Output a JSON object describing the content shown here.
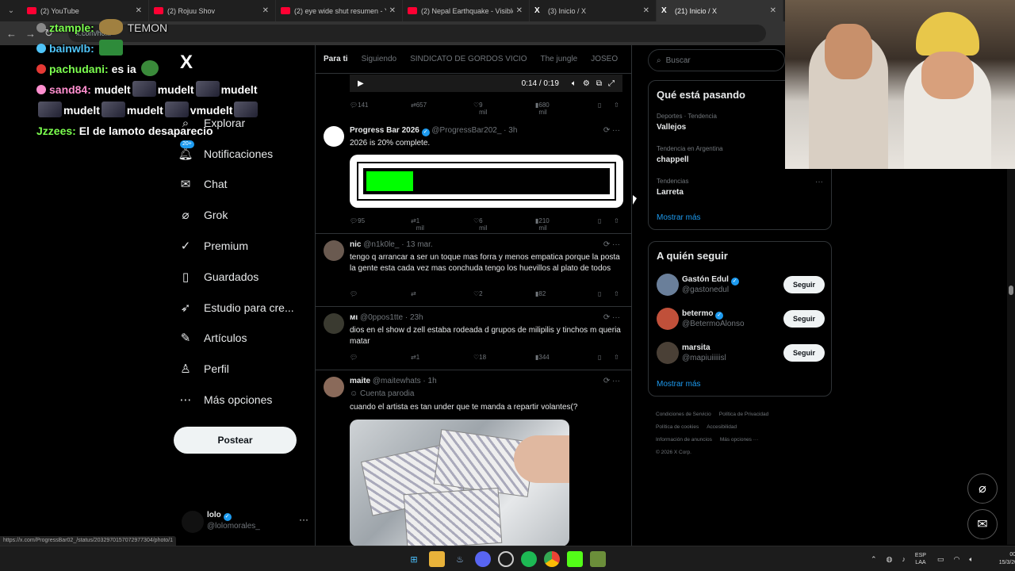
{
  "browser": {
    "tabs": [
      {
        "title": "(2) YouTube",
        "icon": "youtube-icon"
      },
      {
        "title": "(2) Rojuu Shov",
        "icon": "youtube-icon"
      },
      {
        "title": "(2) eye wide shut resumen - Yo",
        "icon": "youtube-icon"
      },
      {
        "title": "(2) Nepal Earthquake - Visible",
        "icon": "youtube-icon"
      },
      {
        "title": "(3) Inicio / X",
        "icon": "x-icon"
      },
      {
        "title": "(21) Inicio / X",
        "icon": "x-icon"
      }
    ],
    "url": "x.com/ho...",
    "status_url": "https://x.com/ProgressBar02_/status/2032970157072977304/photo/1"
  },
  "chat": {
    "lines": [
      {
        "user": "ztample:",
        "msg": "",
        "extra": "TEMON"
      },
      {
        "user": "bainwlb:",
        "msg": ""
      },
      {
        "user": "pachudani:",
        "msg": "es ia"
      },
      {
        "user": "sand84:",
        "msg": "mudelt",
        "msg2": "mudelt",
        "msg3": "mudelt"
      },
      {
        "user": "",
        "msg": "mudelt",
        "msg2": "mudelt",
        "msg3": "vmudelt"
      },
      {
        "user": "Jzzees:",
        "msg": "El de lamoto desaparecio"
      }
    ]
  },
  "sidebar": {
    "logo": "X",
    "items": [
      {
        "label": "Explorar",
        "icon": "search-icon"
      },
      {
        "label": "Notificaciones",
        "icon": "bell-icon",
        "badge": "20+"
      },
      {
        "label": "Chat",
        "icon": "mail-icon"
      },
      {
        "label": "Grok",
        "icon": "grok-icon"
      },
      {
        "label": "Premium",
        "icon": "verified-icon"
      },
      {
        "label": "Guardados",
        "icon": "bookmark-icon"
      },
      {
        "label": "Estudio para cre...",
        "icon": "rocket-icon"
      },
      {
        "label": "Artículos",
        "icon": "article-icon"
      },
      {
        "label": "Perfil",
        "icon": "person-icon"
      },
      {
        "label": "Más opciones",
        "icon": "more-icon"
      }
    ],
    "post_button": "Postear",
    "account": {
      "name": "lolo",
      "handle": "@lolomorales_"
    }
  },
  "feed": {
    "tabs": [
      "Para ti",
      "Siguiendo",
      "SINDICATO DE GORDOS VICIO",
      "The jungle",
      "JOSEO"
    ],
    "video": {
      "time": "0:14 / 0:19"
    },
    "video_actions": {
      "replies": "141",
      "reposts": "657",
      "likes": "9 mil",
      "views": "680 mil"
    },
    "tweets": [
      {
        "name": "Progress Bar 2026",
        "handle": "@ProgressBar202_",
        "time": "3h",
        "text": "2026 is 20% complete.",
        "progress": 0.2,
        "replies": "95",
        "reposts": "1 mil",
        "likes": "6 mil",
        "views": "210 mil"
      },
      {
        "name": "nic",
        "handle": "@n1k0le_",
        "time": "13 mar.",
        "text": "tengo q arrancar a ser un toque mas forra y menos empatica porque la posta la gente esta cada vez mas conchuda tengo los huevillos al plato de todos",
        "replies": "",
        "reposts": "",
        "likes": "2",
        "views": "82"
      },
      {
        "name": "мι",
        "handle": "@0ppos1tte",
        "time": "23h",
        "text": "dios en el show d zell estaba rodeada d grupos de milipilis y tinchos m queria matar",
        "replies": "",
        "reposts": "1",
        "likes": "18",
        "views": "344"
      },
      {
        "name": "maite",
        "handle": "@maitewhats",
        "time": "1h",
        "label": "Cuenta parodia",
        "text": "cuando el artista es tan under que te manda a repartir volantes(?"
      }
    ]
  },
  "right": {
    "search_placeholder": "Buscar",
    "trends_title": "Qué está pasando",
    "trends": [
      {
        "context": "Deportes · Tendencia",
        "name": "Vallejos"
      },
      {
        "context": "Tendencia en Argentina",
        "name": "chappell"
      },
      {
        "context": "Tendencias",
        "name": "Larreta"
      }
    ],
    "show_more": "Mostrar más",
    "follow_title": "A quién seguir",
    "follows": [
      {
        "name": "Gastón Edul",
        "handle": "@gastonedul",
        "verified": true,
        "color": "#6a7f9a"
      },
      {
        "name": "betermo",
        "handle": "@BetermoAlonso",
        "verified": true,
        "color": "#c0503a"
      },
      {
        "name": "marsita",
        "handle": "@mapiuiiiiisl",
        "verified": false,
        "color": "#4a4036"
      }
    ],
    "follow_button": "Seguir",
    "footer": [
      "Condiciones de Servicio",
      "Política de Privacidad",
      "Política de cookies",
      "Accesibilidad",
      "Información de anuncios",
      "Más opciones ···",
      "© 2026 X Corp."
    ]
  },
  "taskbar": {
    "lang1": "ESP",
    "lang2": "LAA",
    "time": "00:25",
    "date": "15/3/2026"
  }
}
